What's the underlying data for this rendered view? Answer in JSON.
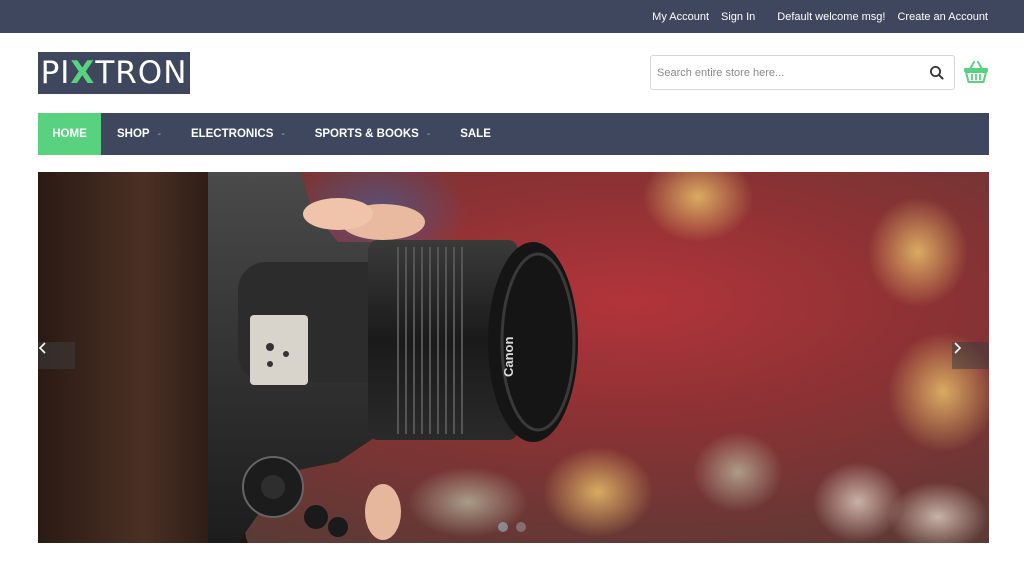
{
  "topbar": {
    "my_account": "My Account",
    "sign_in": "Sign In",
    "welcome": "Default welcome msg!",
    "create_account": "Create an Account"
  },
  "logo": {
    "part1": "PI",
    "part2": "X",
    "part3": "TRON"
  },
  "search": {
    "placeholder": "Search entire store here...",
    "icon": "search-icon"
  },
  "cart": {
    "icon": "shopping-basket-icon"
  },
  "nav": {
    "items": [
      {
        "label": "HOME",
        "active": true
      },
      {
        "label": "SHOP",
        "has_dropdown": true
      },
      {
        "label": "ELECTRONICS",
        "has_dropdown": true
      },
      {
        "label": "SPORTS & BOOKS",
        "has_dropdown": true
      },
      {
        "label": "SALE"
      }
    ],
    "caret": "-"
  },
  "hero": {
    "lens_brand": "Canon",
    "prev_icon": "chevron-left-icon",
    "next_icon": "chevron-right-icon",
    "slides": 2,
    "active_slide": 1
  },
  "colors": {
    "navy": "#3f475e",
    "accent_green": "#58d27e"
  }
}
